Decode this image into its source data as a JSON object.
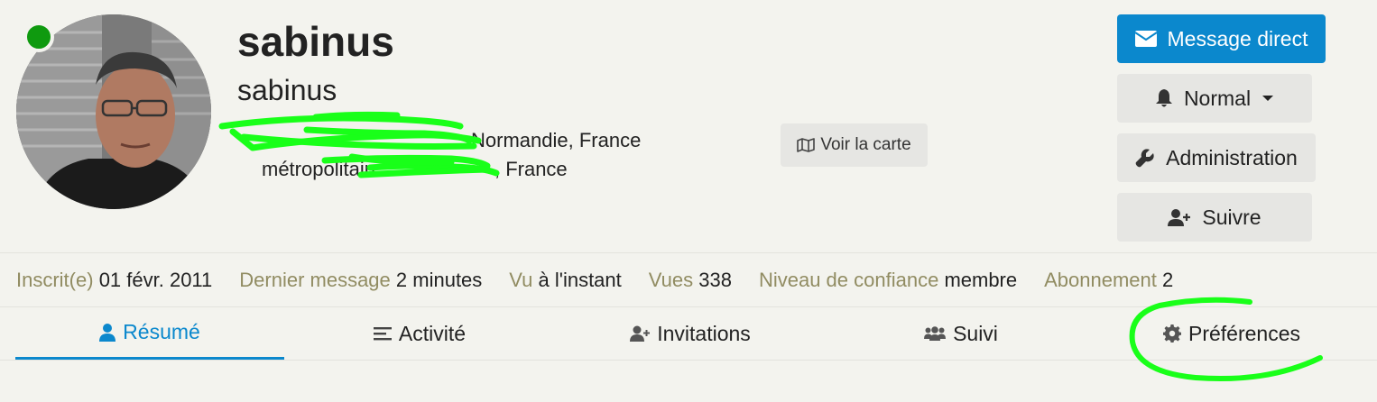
{
  "profile": {
    "username": "sabinus",
    "full_name": "sabinus",
    "online_status_color": "#0f9a0f",
    "location_line1": "Normandie, France",
    "location_line2_start": "métropolitain",
    "location_line2_end": "France"
  },
  "map_button": {
    "label": "Voir la carte",
    "icon": "map-icon"
  },
  "actions": {
    "message": {
      "label": "Message direct",
      "icon": "envelope-icon"
    },
    "notify": {
      "label": "Normal",
      "icon": "bell-icon"
    },
    "admin": {
      "label": "Administration",
      "icon": "wrench-icon"
    },
    "follow": {
      "label": "Suivre",
      "icon": "user-plus-icon"
    }
  },
  "stats": [
    {
      "label": "Inscrit(e)",
      "value": "01 févr. 2011"
    },
    {
      "label": "Dernier message",
      "value": "2 minutes"
    },
    {
      "label": "Vu",
      "value": "à l'instant"
    },
    {
      "label": "Vues",
      "value": "338"
    },
    {
      "label": "Niveau de confiance",
      "value": "membre"
    },
    {
      "label": "Abonnement",
      "value": "2"
    }
  ],
  "tabs": [
    {
      "label": "Résumé",
      "icon": "user-icon",
      "active": true
    },
    {
      "label": "Activité",
      "icon": "list-icon",
      "active": false
    },
    {
      "label": "Invitations",
      "icon": "user-plus-icon",
      "active": false
    },
    {
      "label": "Suivi",
      "icon": "users-icon",
      "active": false
    },
    {
      "label": "Préférences",
      "icon": "gear-icon",
      "active": false
    }
  ],
  "colors": {
    "accent": "#0b88cd",
    "stat_label": "#918c62",
    "annotation": "#19ff19",
    "background": "#f3f3ee"
  }
}
